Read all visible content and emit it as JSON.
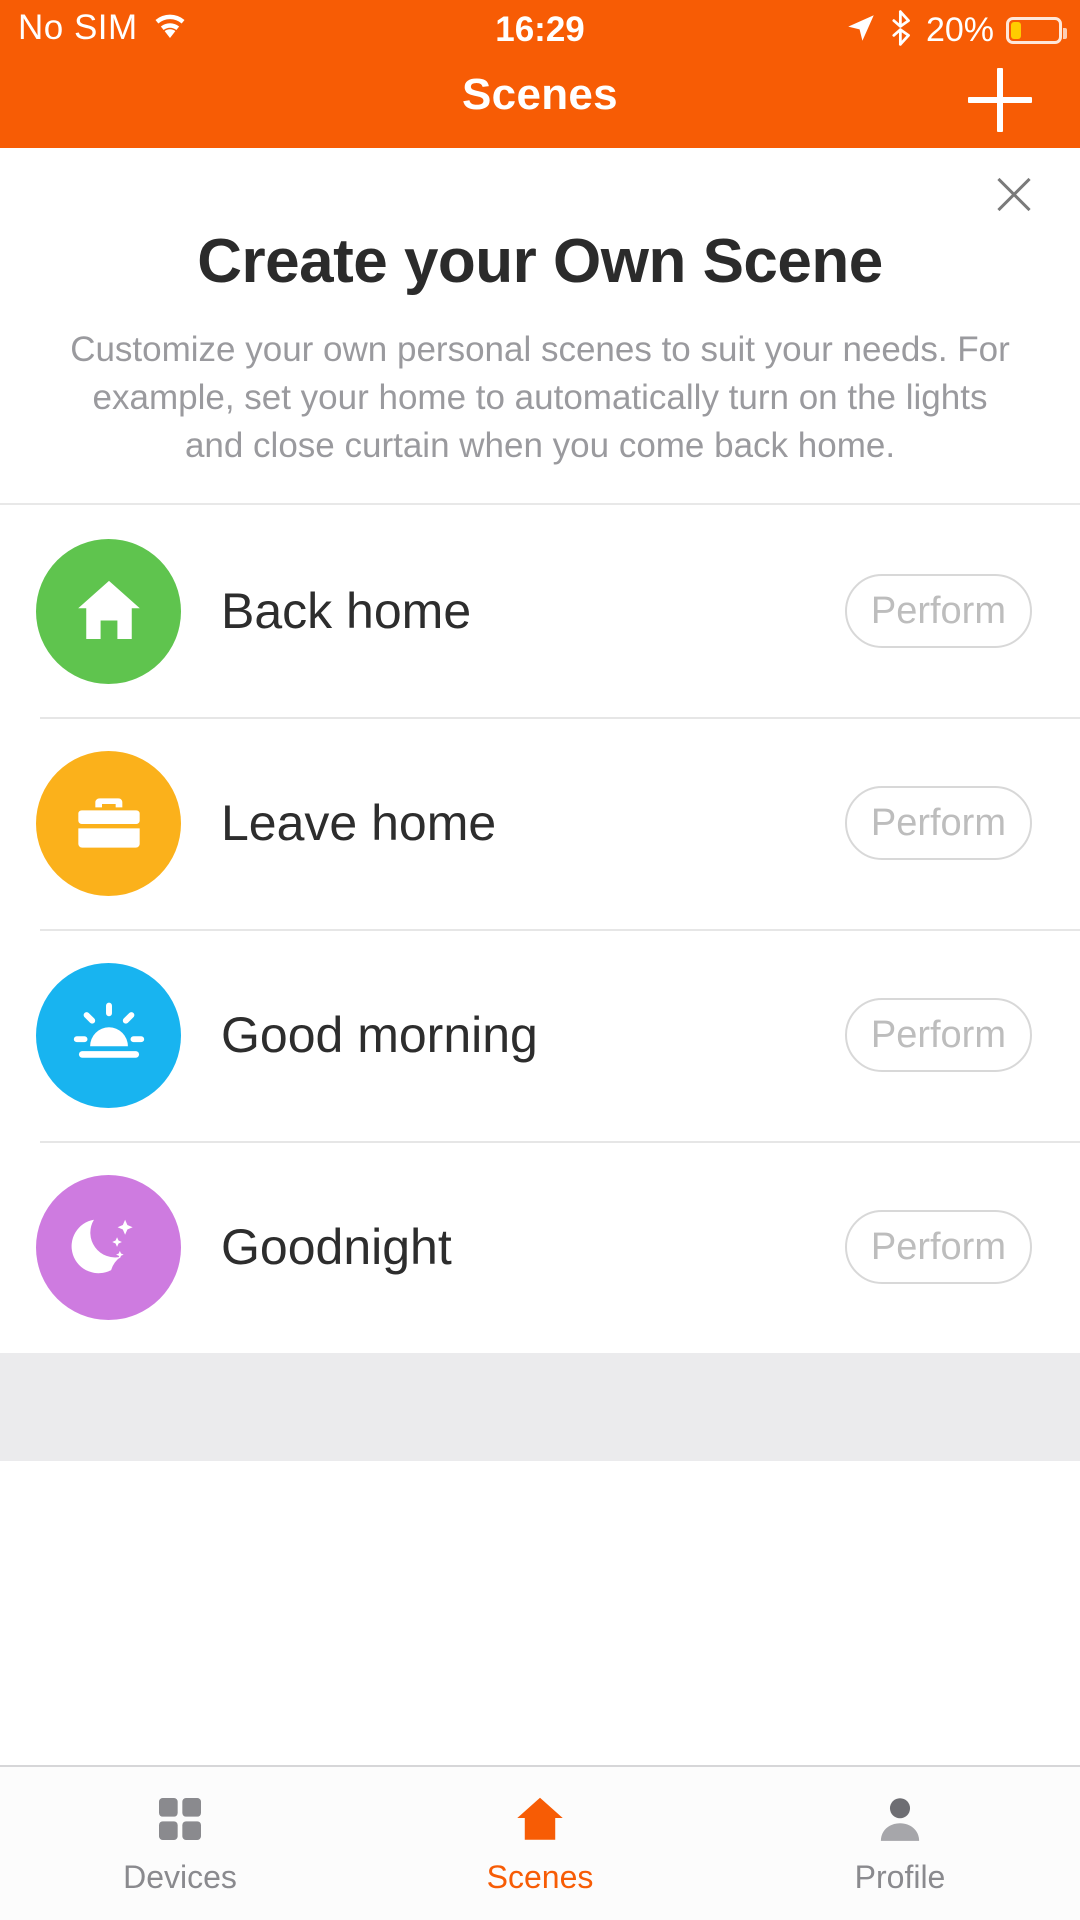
{
  "status_bar": {
    "carrier": "No SIM",
    "wifi_icon": "wifi-icon",
    "time": "16:29",
    "location_icon": "location-arrow-icon",
    "bluetooth_icon": "bluetooth-icon",
    "battery_percent": "20%",
    "battery_level": 20,
    "battery_icon": "battery-low-icon"
  },
  "header": {
    "title": "Scenes",
    "add_icon": "plus-icon",
    "background_color": "#F75C05"
  },
  "promo": {
    "close_icon": "close-icon",
    "title": "Create your Own Scene",
    "description": "Customize your own personal scenes to suit your needs. For example, set your home to automatically turn on the lights and close curtain when you come back home."
  },
  "scenes": [
    {
      "name": "Back home",
      "icon": "home-icon",
      "icon_color": "#5FC44E",
      "action_label": "Perform"
    },
    {
      "name": "Leave home",
      "icon": "briefcase-icon",
      "icon_color": "#FBB11B",
      "action_label": "Perform"
    },
    {
      "name": "Good morning",
      "icon": "sunrise-icon",
      "icon_color": "#18B4F0",
      "action_label": "Perform"
    },
    {
      "name": "Goodnight",
      "icon": "moon-stars-icon",
      "icon_color": "#CE7BE0",
      "action_label": "Perform"
    }
  ],
  "tab_bar": {
    "active_color": "#F75C05",
    "inactive_color": "#8A8A8E",
    "tabs": [
      {
        "label": "Devices",
        "icon": "grid-icon",
        "active": false
      },
      {
        "label": "Scenes",
        "icon": "home-icon",
        "active": true
      },
      {
        "label": "Profile",
        "icon": "person-icon",
        "active": false
      }
    ]
  }
}
